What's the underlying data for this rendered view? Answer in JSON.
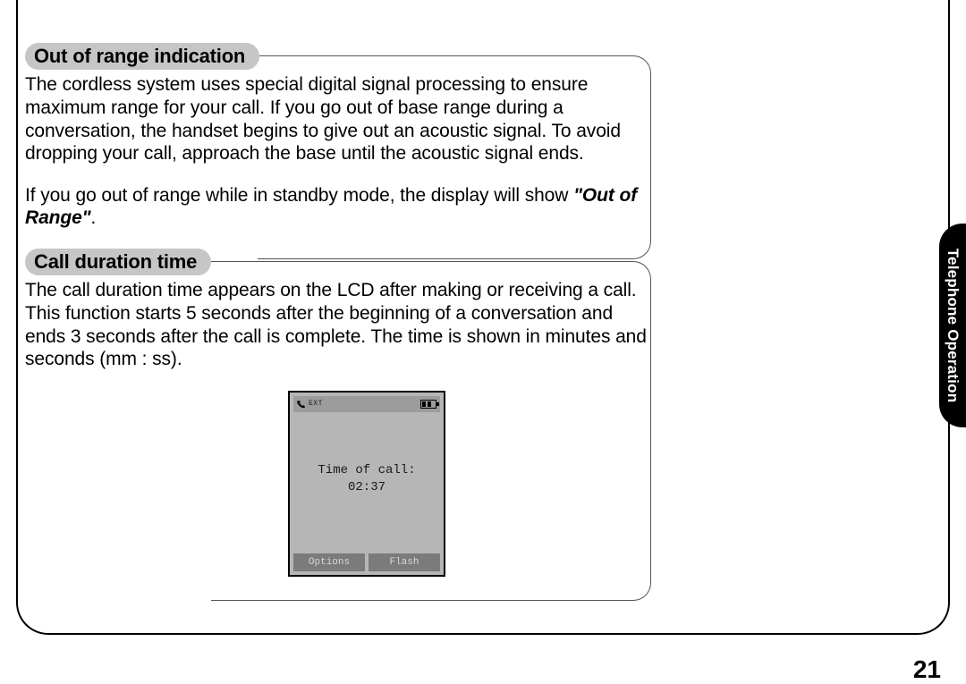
{
  "sections": {
    "out_of_range": {
      "heading": "Out of range indication",
      "para1": "The cordless system uses special digital signal processing to ensure maximum range for your call. If you go out of base range during a conversation, the handset begins to give out an acoustic signal. To avoid dropping your call, approach the base until the acoustic signal ends.",
      "para2_lead": "If you go out of range while in standby mode, the display will show ",
      "para2_quote": "\"Out of Range\"",
      "para2_tail": "."
    },
    "call_duration": {
      "heading": "Call duration time",
      "para1": "The call duration time appears on the LCD after making or receiving a call. This function starts 5 seconds after the beginning of a conversation and ends 3 seconds after the call is complete. The time is shown in minutes and seconds (mm : ss)."
    }
  },
  "lcd": {
    "top_label": "EXT",
    "line1": "Time of call:",
    "line2": "02:37",
    "softkey_left": "Options",
    "softkey_right": "Flash"
  },
  "side_tab": "Telephone Operation",
  "page_number": "21"
}
